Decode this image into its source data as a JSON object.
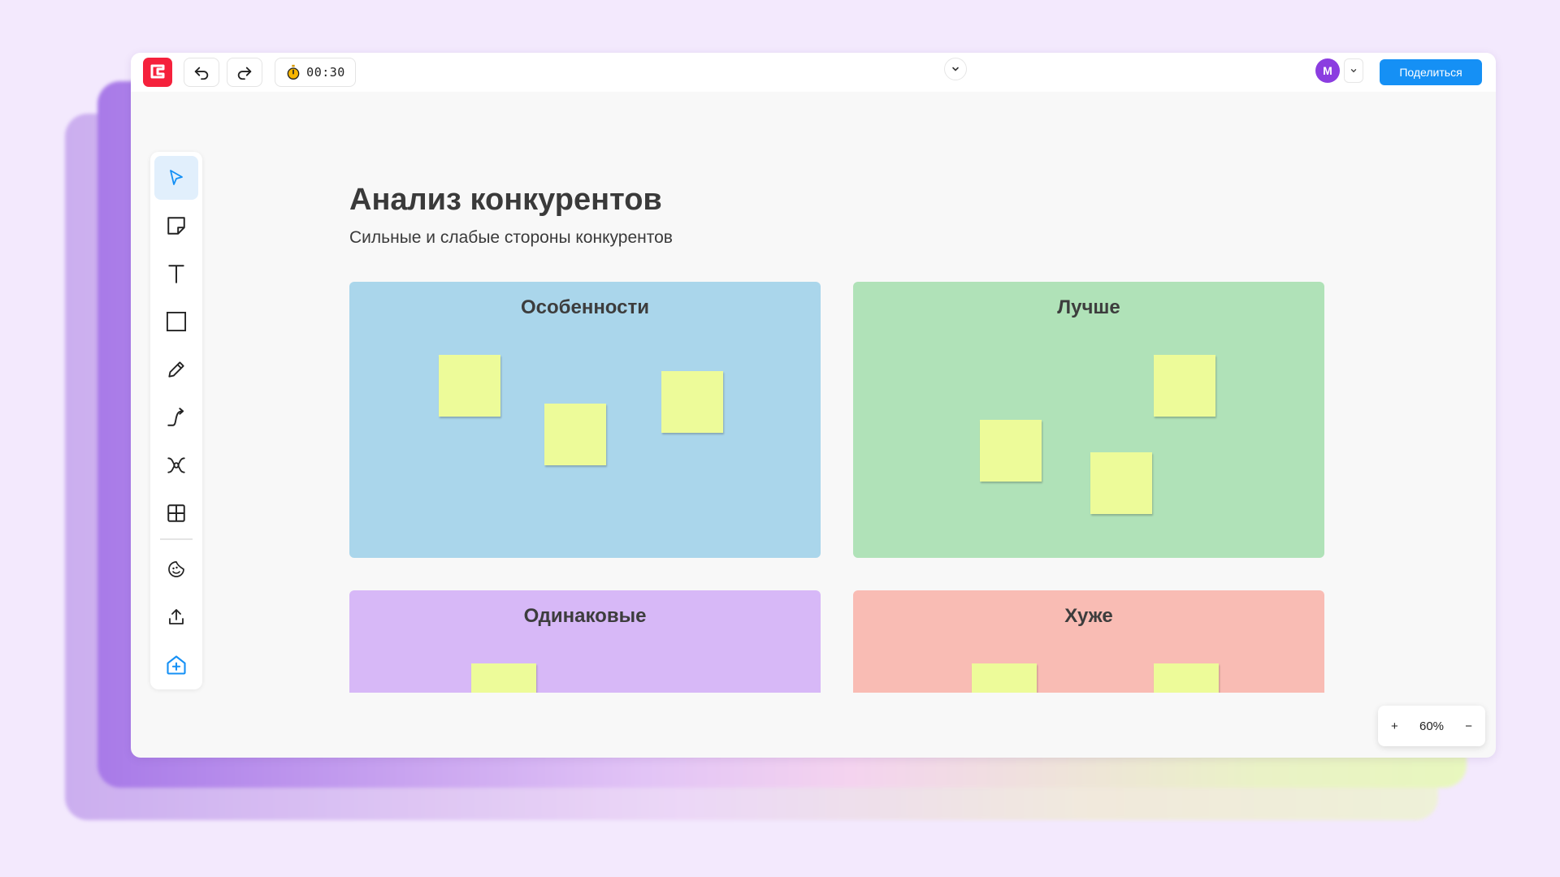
{
  "toolbar_top": {
    "timer": "00:30",
    "share_label": "Поделиться",
    "avatar_initial": "M"
  },
  "board": {
    "title": "Анализ конкурентов",
    "subtitle": "Сильные и слабые стороны конкурентов"
  },
  "frames": [
    {
      "title": "Особенности",
      "color": "#aad6eb"
    },
    {
      "title": "Лучше",
      "color": "#b0e2b8"
    },
    {
      "title": "Одинаковые",
      "color": "#d7b8f7"
    },
    {
      "title": "Хуже",
      "color": "#f9bcb4"
    }
  ],
  "note_color": "#edfb99",
  "tools": [
    "select-icon",
    "sticky-note-icon",
    "text-icon",
    "rectangle-icon",
    "pen-icon",
    "connector-icon",
    "mindmap-icon",
    "table-icon",
    "sticker-icon",
    "upload-icon",
    "add-app-icon"
  ],
  "zoom": {
    "plus": "+",
    "level": "60%",
    "minus": "−"
  },
  "colors": {
    "accent": "#1590f5",
    "logo": "#f5213c",
    "avatar": "#8b3de0"
  }
}
